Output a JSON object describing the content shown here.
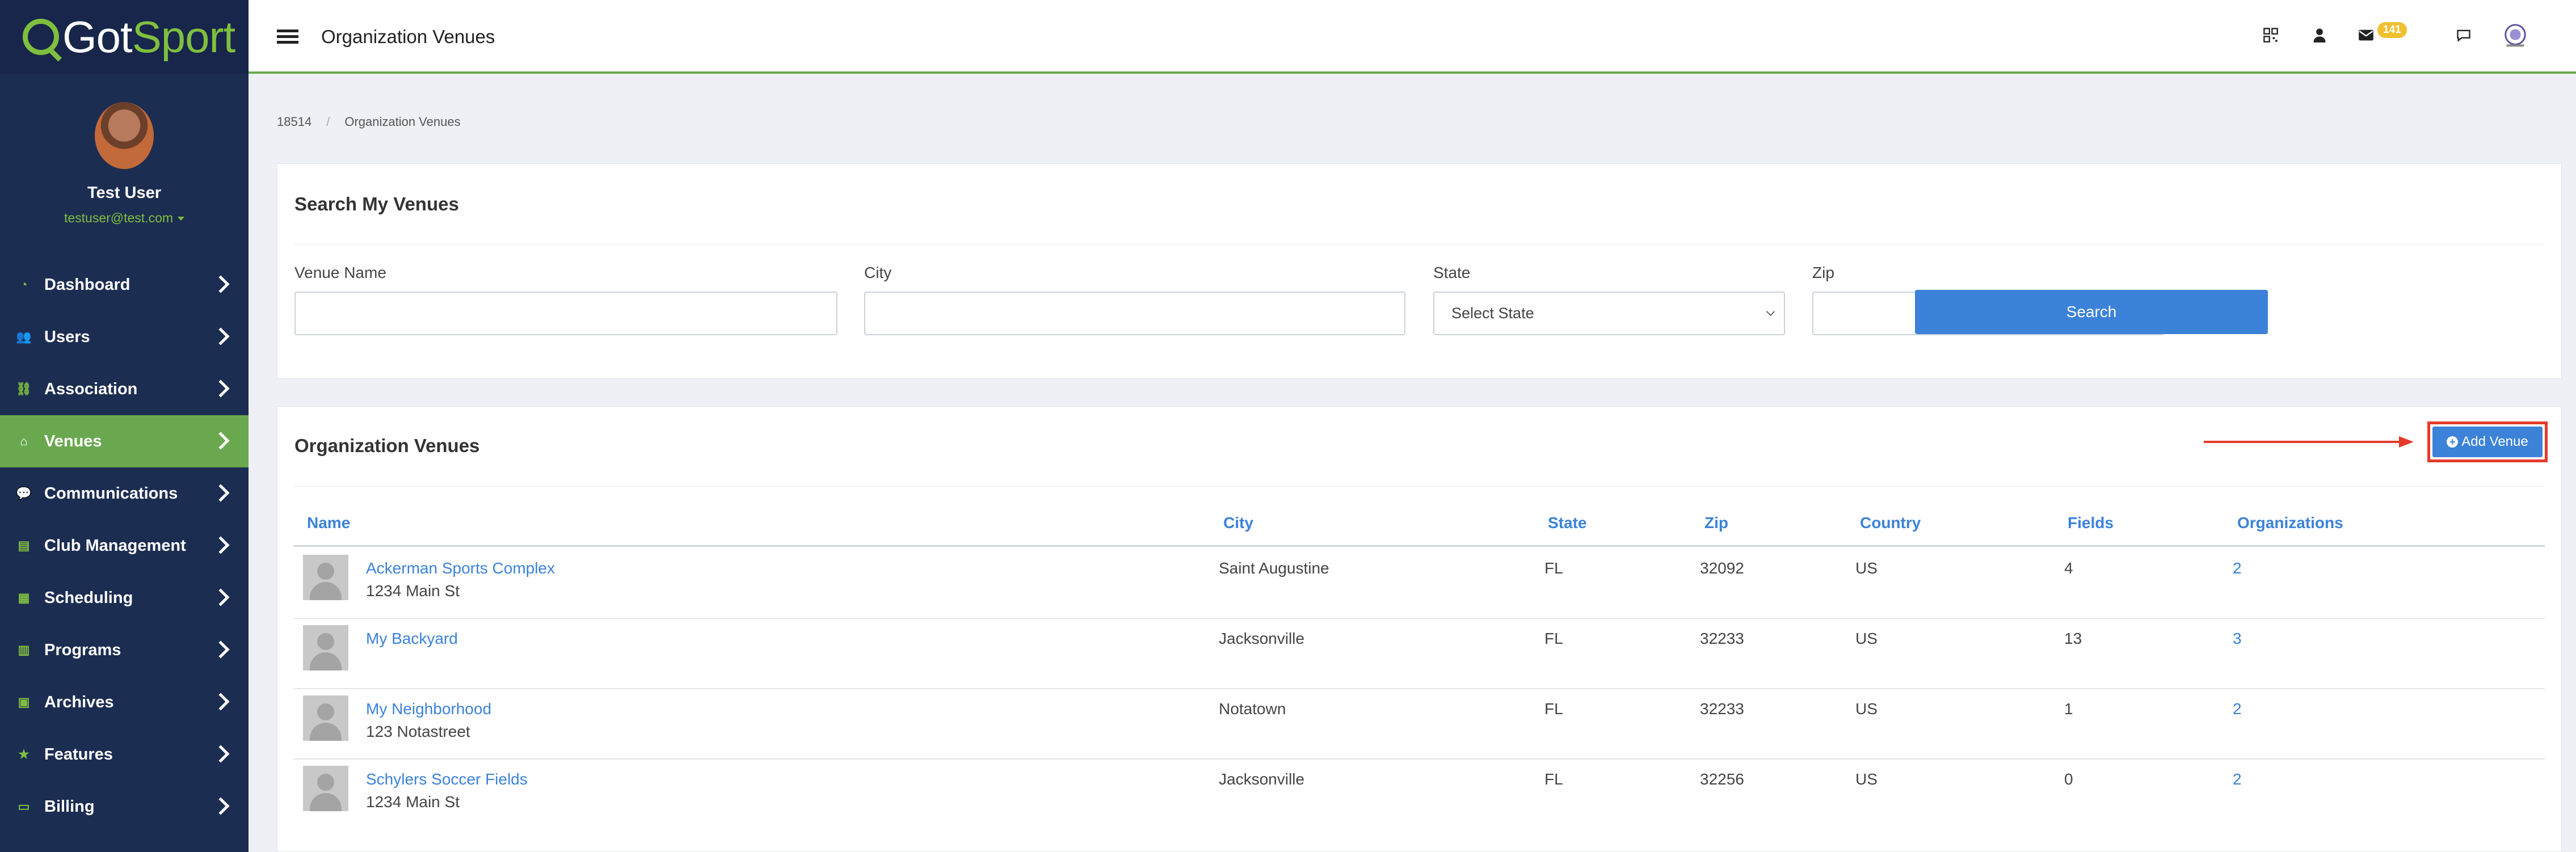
{
  "brand": {
    "logo_text_1": "Got",
    "logo_text_2": "Sport"
  },
  "profile": {
    "name": "Test User",
    "email": "testuser@test.com"
  },
  "sidebar": {
    "items": [
      {
        "label": "Dashboard",
        "icon": "dashboard-icon"
      },
      {
        "label": "Users",
        "icon": "users-icon"
      },
      {
        "label": "Association",
        "icon": "association-icon"
      },
      {
        "label": "Venues",
        "icon": "home-icon",
        "active": true
      },
      {
        "label": "Communications",
        "icon": "chat-icon"
      },
      {
        "label": "Club Management",
        "icon": "club-icon"
      },
      {
        "label": "Scheduling",
        "icon": "calendar-icon"
      },
      {
        "label": "Programs",
        "icon": "document-icon"
      },
      {
        "label": "Archives",
        "icon": "archive-icon"
      },
      {
        "label": "Features",
        "icon": "star-icon"
      },
      {
        "label": "Billing",
        "icon": "credit-card-icon"
      }
    ]
  },
  "topbar": {
    "title": "Organization Venues",
    "message_count": "141"
  },
  "breadcrumb": {
    "root": "18514",
    "current": "Organization Venues"
  },
  "search": {
    "title": "Search My Venues",
    "venue_name_label": "Venue Name",
    "venue_name_value": "",
    "city_label": "City",
    "city_value": "",
    "state_label": "State",
    "state_value": "Select State",
    "zip_label": "Zip",
    "zip_value": "",
    "button": "Search"
  },
  "venues": {
    "title": "Organization Venues",
    "add_button": "Add Venue",
    "columns": [
      "Name",
      "City",
      "State",
      "Zip",
      "Country",
      "Fields",
      "Organizations"
    ],
    "rows": [
      {
        "name": "Ackerman Sports Complex",
        "address": "1234 Main St",
        "city": "Saint Augustine",
        "state": "FL",
        "zip": "32092",
        "country": "US",
        "fields": "4",
        "organizations": "2"
      },
      {
        "name": "My Backyard",
        "address": "",
        "city": "Jacksonville",
        "state": "FL",
        "zip": "32233",
        "country": "US",
        "fields": "13",
        "organizations": "3"
      },
      {
        "name": "My Neighborhood",
        "address": "123 Notastreet",
        "city": "Notatown",
        "state": "FL",
        "zip": "32233",
        "country": "US",
        "fields": "1",
        "organizations": "2"
      },
      {
        "name": "Schylers Soccer Fields",
        "address": "1234 Main St",
        "city": "Jacksonville",
        "state": "FL",
        "zip": "32256",
        "country": "US",
        "fields": "0",
        "organizations": "2"
      }
    ]
  },
  "colors": {
    "sidebar": "#1c2d52",
    "accent_green": "#6aa84f",
    "primary_blue": "#3b82d8",
    "highlight_red": "#e53a2a",
    "badge": "#f0c030"
  }
}
